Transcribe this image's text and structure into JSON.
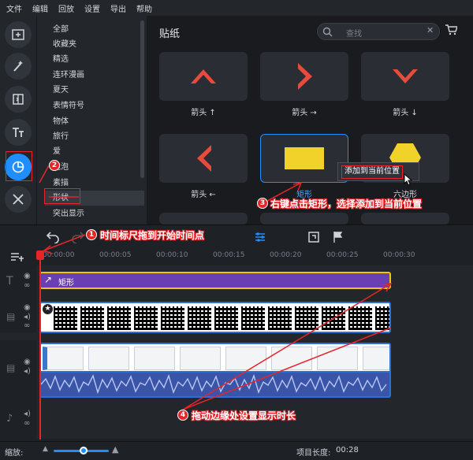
{
  "menu": [
    "文件",
    "编辑",
    "回放",
    "设置",
    "导出",
    "帮助"
  ],
  "categories": [
    "全部",
    "收藏夹",
    "精选",
    "连环漫画",
    "夏天",
    "表情符号",
    "物体",
    "旅行",
    "爱",
    "泡泡",
    "素描",
    "形状",
    "突出显示"
  ],
  "selected_category": "形状",
  "content": {
    "title": "贴纸",
    "search_placeholder": "查找"
  },
  "stickers": [
    {
      "label": "箭头 ↑",
      "shape": "arrow-up-icon"
    },
    {
      "label": "箭头 →",
      "shape": "arrow-right-icon"
    },
    {
      "label": "箭头 ↓",
      "shape": "arrow-down-icon"
    },
    {
      "label": "箭头 ←",
      "shape": "arrow-left-icon"
    },
    {
      "label": "矩形",
      "shape": "rectangle-icon"
    },
    {
      "label": "六边形",
      "shape": "hexagon-icon"
    }
  ],
  "context_menu": {
    "item": "添加到当前位置"
  },
  "timeline": {
    "ticks": [
      "00:00:00",
      "00:00:05",
      "00:00:10",
      "00:00:15",
      "00:00:20",
      "00:00:25",
      "00:00:30"
    ],
    "sticker_clip_label": "矩形"
  },
  "status": {
    "zoom_label": "缩放:",
    "length_label": "项目长度:",
    "length_value": "00:28"
  },
  "annotations": {
    "a1": "时间标尺拖到开始时间点",
    "a2": "",
    "a3": "右键点击矩形，选择添加到当前位置",
    "a4": "拖动边缘处设置显示时长",
    "n1": "1",
    "n2": "2",
    "n3": "3",
    "n4": "4"
  },
  "colors": {
    "accent": "#1f8fff",
    "sticker_red": "#e84a3c",
    "sticker_yellow": "#f1d22a",
    "clip_purple": "#6a3fb3",
    "annotation_red": "#e5252a"
  }
}
